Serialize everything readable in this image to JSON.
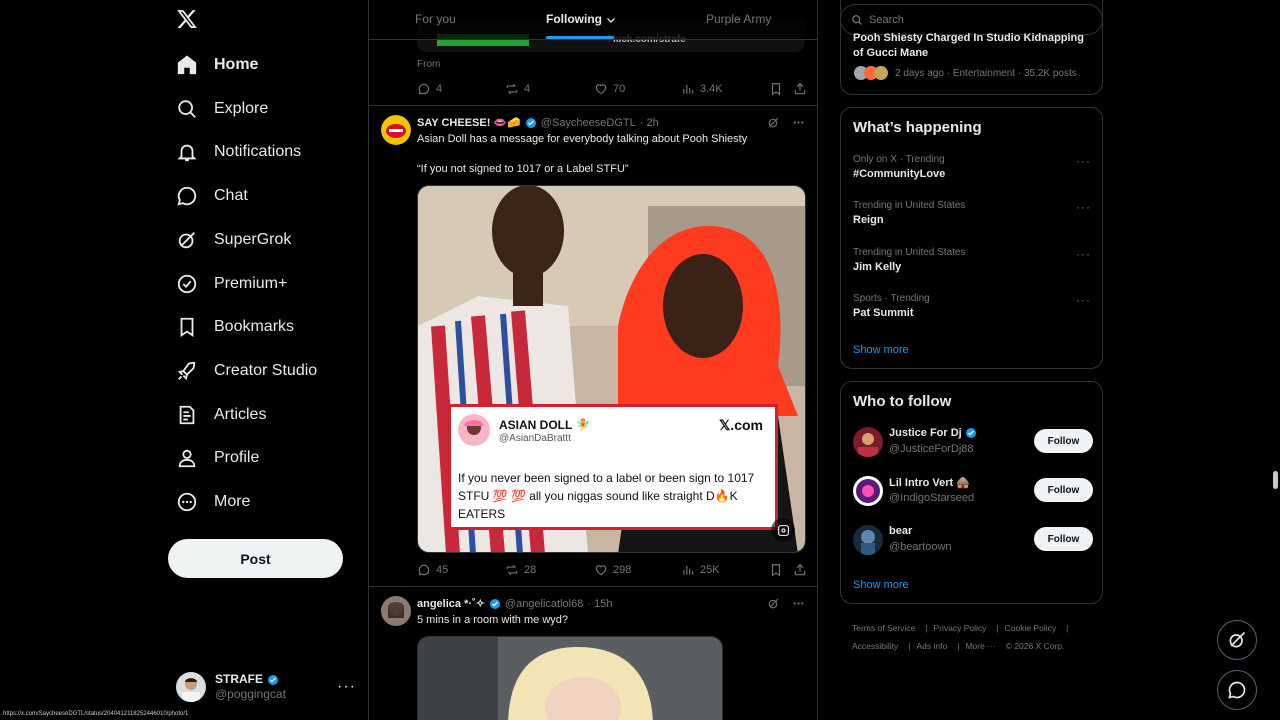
{
  "nav": {
    "items": [
      {
        "label": "Home",
        "icon": "home-icon"
      },
      {
        "label": "Explore",
        "icon": "search-icon"
      },
      {
        "label": "Notifications",
        "icon": "bell-icon"
      },
      {
        "label": "Chat",
        "icon": "chat-icon"
      },
      {
        "label": "SuperGrok",
        "icon": "grok-icon"
      },
      {
        "label": "Premium+",
        "icon": "verified-icon"
      },
      {
        "label": "Bookmarks",
        "icon": "bookmark-icon"
      },
      {
        "label": "Creator Studio",
        "icon": "rocket-icon"
      },
      {
        "label": "Articles",
        "icon": "articles-icon"
      },
      {
        "label": "Profile",
        "icon": "person-icon"
      },
      {
        "label": "More",
        "icon": "more-circle-icon"
      }
    ],
    "post_label": "Post"
  },
  "account": {
    "name": "STRAFE",
    "handle": "@poggingcat",
    "more": "···"
  },
  "tabs": [
    {
      "label": "For you"
    },
    {
      "label": "Following"
    },
    {
      "label": "Purple Army"
    }
  ],
  "prev_tweet": {
    "from_label": "From",
    "media_text": "kick.com/strafe",
    "stats": {
      "replies": "4",
      "reposts": "4",
      "likes": "70",
      "views": "3.4K"
    }
  },
  "tweet1": {
    "name": "SAY CHEESE! 👄🧀",
    "handle": "@SaycheeseDGTL",
    "time": "· 2h",
    "line1": "Asian Doll has a message for everybody talking about Pooh Shiesty",
    "line2": "“If you not signed to 1017 or a Label STFU”",
    "quote": {
      "name": "ASIAN DOLL 🧚",
      "handle": "@AsianDaBrattt",
      "brand": "𝕏.com",
      "text": "If you never been signed to a label  or been sign to 1017 STFU 💯 💯 all you niggas sound like straight D🔥K EATERS"
    },
    "stats": {
      "replies": "45",
      "reposts": "28",
      "likes": "298",
      "views": "25K"
    }
  },
  "tweet2": {
    "name": "angelica *·˚✧",
    "handle": "@angelicatlol68",
    "time": "· 15h",
    "text": "5 mins in a room with me wyd?"
  },
  "search": {
    "placeholder": "Search"
  },
  "top_card": {
    "title": "Pooh Shiesty Charged In Studio Kidnapping of Gucci Mane",
    "meta": "2 days ago · Entertainment · 35.2K posts"
  },
  "whats_happening": {
    "title": "What’s happening",
    "trends": [
      {
        "context": "Only on X · Trending",
        "name": "#CommunityLove"
      },
      {
        "context": "Trending in United States",
        "name": "Reign"
      },
      {
        "context": "Trending in United States",
        "name": "Jim Kelly"
      },
      {
        "context": "Sports · Trending",
        "name": "Pat Summit"
      }
    ],
    "show_more": "Show more"
  },
  "who_to_follow": {
    "title": "Who to follow",
    "users": [
      {
        "name": "Justice For Dj",
        "handle": "@JusticeForDj88",
        "follow": "Follow"
      },
      {
        "name": "Lil Intro Vert 🛖",
        "handle": "@IndigoStarseed",
        "follow": "Follow"
      },
      {
        "name": "bear",
        "handle": "@beartoown",
        "follow": "Follow"
      }
    ],
    "show_more": "Show more"
  },
  "footer": {
    "links": [
      "Terms of Service",
      "Privacy Policy",
      "Cookie Policy",
      "Accessibility",
      "Ads info",
      "More ···",
      "© 2026 X Corp."
    ]
  },
  "status_url": "https://x.com/SaycheeseDGTL/status/2040412118252446010/photo/1",
  "colors": {
    "accent": "#1d9bf0",
    "background": "#000000",
    "border": "#2f3336",
    "muted": "#71767b"
  }
}
